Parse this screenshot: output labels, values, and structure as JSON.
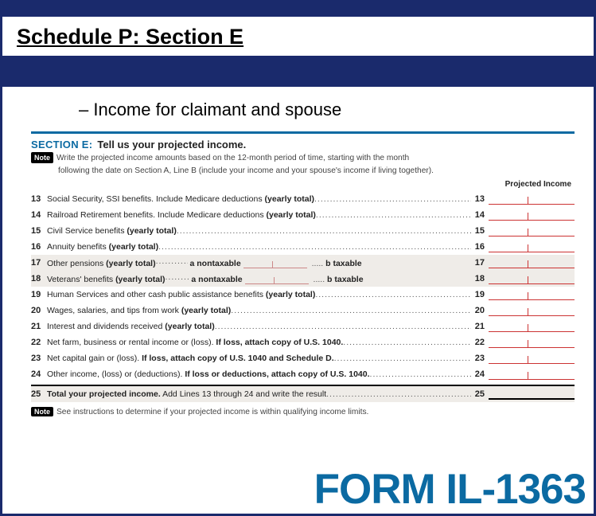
{
  "header": {
    "title": "Schedule P: Section E"
  },
  "subtitle": "– Income for claimant and spouse",
  "section": {
    "tag": "SECTION E:",
    "title": "Tell us your projected income.",
    "note_badge": "Note",
    "note1": "Write the projected income amounts based on the 12-month period of time, starting with the month",
    "note2": "following the date on Section A, Line B (include your income and your spouse's income if living together).",
    "proj_header": "Projected Income"
  },
  "lines": [
    {
      "n": "13",
      "text": "Social Security, SSI benefits. Include Medicare deductions ",
      "bold": "(yearly total)",
      "r": "13"
    },
    {
      "n": "14",
      "text": "Railroad Retirement benefits. Include Medicare deductions ",
      "bold": "(yearly total)",
      "r": "14"
    },
    {
      "n": "15",
      "text": "Civil Service benefits ",
      "bold": "(yearly total)",
      "r": "15"
    },
    {
      "n": "16",
      "text": "Annuity benefits ",
      "bold": "(yearly total)",
      "r": "16"
    },
    {
      "n": "17",
      "text": "Other pensions ",
      "bold": "(yearly total)",
      "mid_a": "a nontaxable",
      "mid_b": "b taxable",
      "r": "17"
    },
    {
      "n": "18",
      "text": "Veterans' benefits ",
      "bold": "(yearly total)",
      "mid_a": "a nontaxable",
      "mid_b": "b taxable",
      "r": "18"
    },
    {
      "n": "19",
      "text": "Human Services and other cash public assistance benefits ",
      "bold": "(yearly total)",
      "r": "19"
    },
    {
      "n": "20",
      "text": "Wages, salaries, and tips from work ",
      "bold": "(yearly total)",
      "r": "20"
    },
    {
      "n": "21",
      "text": "Interest and dividends received ",
      "bold": "(yearly total)",
      "r": "21"
    },
    {
      "n": "22",
      "text": "Net farm, business or rental income or (loss). ",
      "bold": "If loss, attach copy of U.S. 1040.",
      "r": "22"
    },
    {
      "n": "23",
      "text": "Net capital gain or (loss). ",
      "bold": "If loss, attach copy of U.S. 1040 and Schedule D.",
      "r": "23"
    },
    {
      "n": "24",
      "text": "Other income, (loss) or (deductions). ",
      "bold": "If loss or deductions, attach copy of U.S. 1040.",
      "r": "24"
    }
  ],
  "total": {
    "n": "25",
    "bold": "Total your projected income.",
    "text": " Add Lines 13 through 24 and write the result",
    "r": "25"
  },
  "footnote": {
    "badge": "Note",
    "text": "See instructions to determine if your projected income is within qualifying income limits."
  },
  "footer": {
    "form": "FORM IL-1363"
  }
}
